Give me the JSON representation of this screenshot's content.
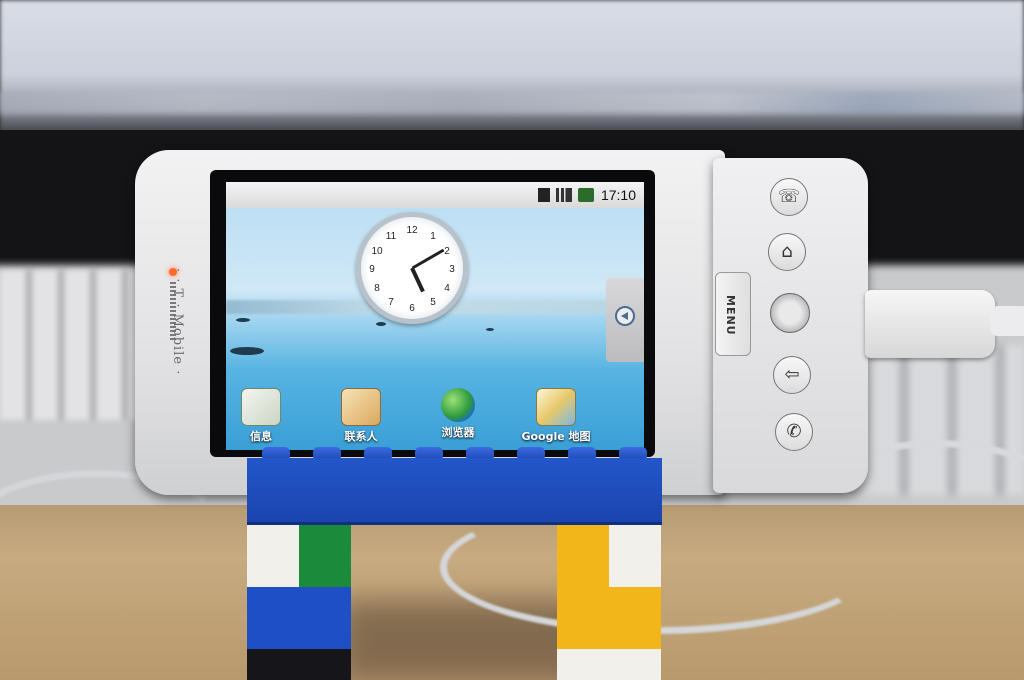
{
  "phone": {
    "brand": "· · T · Mobile ·",
    "menu_label": "MENU",
    "status_time": "17:10",
    "clock_numbers": [
      "12",
      "1",
      "2",
      "3",
      "4",
      "5",
      "6",
      "7",
      "8",
      "9",
      "10",
      "11"
    ],
    "apps": [
      {
        "label": "信息",
        "icon": "messaging-icon"
      },
      {
        "label": "联系人",
        "icon": "contacts-icon"
      },
      {
        "label": "浏览器",
        "icon": "browser-globe-icon"
      },
      {
        "label": "Google 地图",
        "icon": "maps-icon"
      }
    ],
    "buttons": [
      "call-phone-icon",
      "home-icon",
      "back-arrow-icon",
      "call-phone-icon"
    ]
  },
  "colors": {
    "lego_blue": "#1f4fc4",
    "lego_green": "#1b8a3a",
    "lego_yellow": "#f2b51a",
    "led": "#ff6a2a"
  }
}
